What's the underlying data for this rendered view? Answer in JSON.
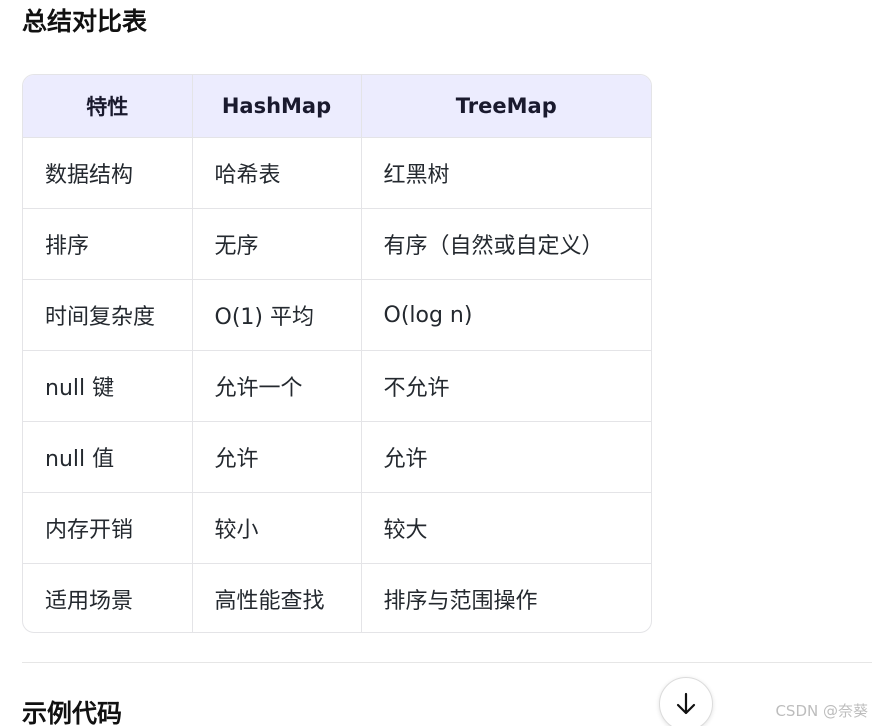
{
  "summary": {
    "title": "总结对比表",
    "headers": [
      "特性",
      "HashMap",
      "TreeMap"
    ],
    "rows": [
      [
        "数据结构",
        "哈希表",
        "红黑树"
      ],
      [
        "排序",
        "无序",
        "有序（自然或自定义）"
      ],
      [
        "时间复杂度",
        "O(1) 平均",
        "O(log n)"
      ],
      [
        "null 键",
        "允许一个",
        "不允许"
      ],
      [
        "null 值",
        "允许",
        "允许"
      ],
      [
        "内存开销",
        "较小",
        "较大"
      ],
      [
        "适用场景",
        "高性能查找",
        "排序与范围操作"
      ]
    ]
  },
  "next_section": {
    "title": "示例代码"
  },
  "scroll_button": {
    "icon": "arrow-down-icon"
  },
  "watermark": "CSDN @奈葵"
}
